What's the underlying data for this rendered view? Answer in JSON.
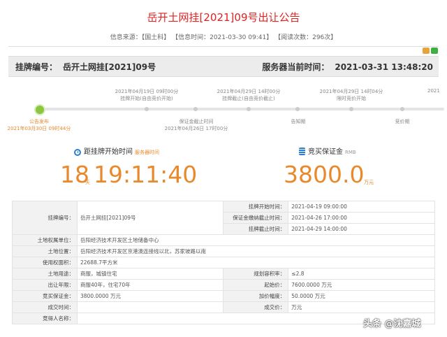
{
  "page": {
    "title": "岳开土网挂[2021]09号出让公告",
    "meta": {
      "source_label": "信息来源：",
      "source_value": "【国土科】",
      "time_label": "【信息时间：",
      "time_value": "2021-03-30 09:41】",
      "reads_label": "【阅读次数：",
      "reads_value": "296次】"
    }
  },
  "header": {
    "listing_label": "挂牌编号：",
    "listing_value": "岳开土网挂[2021]09号",
    "server_label": "服务器当前时间：",
    "server_value": "2021-03-31 13:48:20"
  },
  "timeline": {
    "top": [
      {
        "date": "2021年04月19日 09时00分",
        "event": "挂牌开始(自由竞价开始)"
      },
      {
        "date": "2021年04月29日 14时00分",
        "event": "挂牌截止(自由竞价截止)"
      },
      {
        "date": "2021年04月29日 14时04分",
        "event": "限时竞价开始"
      },
      {
        "date": "2021"
      }
    ],
    "bottom": [
      {
        "event": "公告发布",
        "date": "2021年03月30日 09时44分"
      },
      {
        "event": "保证金截止时间",
        "date": "2021年04月26日 17时00分"
      },
      {
        "event": "告知期"
      },
      {
        "event": "竞价期"
      }
    ]
  },
  "countdown": {
    "label": "距挂牌开始时间",
    "sub": "服务器时间",
    "days": "18",
    "days_unit": "天",
    "time": "19:11:40"
  },
  "deposit": {
    "label": "竞买保证金",
    "sub": "RMB",
    "value": "3800.0",
    "unit": "万元"
  },
  "info_table": {
    "listing_no_label": "挂牌编号：",
    "listing_no": "岳开土网挂[2021]09号",
    "start_label": "挂牌开始时间：",
    "start": "2021-04-19 09:00:00",
    "deposit_deadline_label": "保证金缴纳截止时间：",
    "deposit_deadline": "2021-04-26 17:00:00",
    "end_label": "挂牌截止时间：",
    "end": "2021-04-29 14:00:00",
    "owner_label": "土地权属单位：",
    "owner": "岳阳经济技术开发区土地储备中心",
    "location_label": "土地位置：",
    "location": "岳阳经济技术开发区京港澳连接线以北，苏家坡路以南",
    "area_label": "使用权面积：",
    "area": "22688.7平方米",
    "usage_label": "土地用途：",
    "usage": "商服，城镇住宅",
    "plot_ratio_label": "规划容积率：",
    "plot_ratio": "≤2.8",
    "years_label": "出让年限：",
    "years": "商服40年，住宅70年",
    "start_price_label": "起始价：",
    "start_price": "7600.0000 万元",
    "deposit_label": "竞买保证金：",
    "deposit": "3800.0000 万元",
    "increment_label": "加价幅度：",
    "increment": "50.0000 万元",
    "deal_time_label": "成交时间：",
    "deal_time": "",
    "deal_price_label": "成交价：",
    "deal_price": "万元",
    "bidder_label": "竞得人名称："
  },
  "watermark": "头条 @沈嘉城",
  "colors": {
    "title": "#dd2222",
    "accent": "#e8892c",
    "timeline_active": "#8cc63f",
    "icon_blue": "#2a7fd4"
  }
}
